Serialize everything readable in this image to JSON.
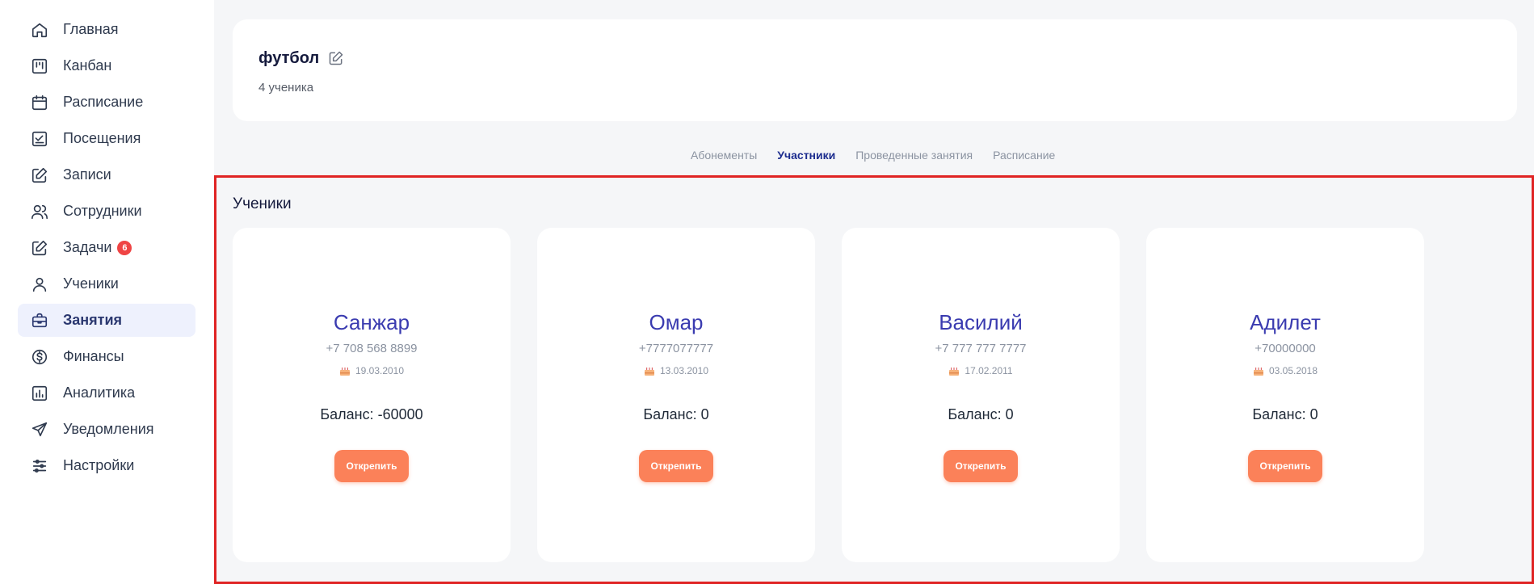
{
  "sidebar": {
    "items": [
      {
        "label": "Главная",
        "icon": "home-icon"
      },
      {
        "label": "Канбан",
        "icon": "kanban-icon"
      },
      {
        "label": "Расписание",
        "icon": "calendar-icon"
      },
      {
        "label": "Посещения",
        "icon": "chart-check-icon"
      },
      {
        "label": "Записи",
        "icon": "edit-note-icon"
      },
      {
        "label": "Сотрудники",
        "icon": "users-icon"
      },
      {
        "label": "Задачи",
        "icon": "tasks-icon",
        "badge": "6"
      },
      {
        "label": "Ученики",
        "icon": "user-icon"
      },
      {
        "label": "Занятия",
        "icon": "briefcase-icon",
        "active": true
      },
      {
        "label": "Финансы",
        "icon": "dollar-icon"
      },
      {
        "label": "Аналитика",
        "icon": "bar-chart-icon"
      },
      {
        "label": "Уведомления",
        "icon": "send-icon"
      },
      {
        "label": "Настройки",
        "icon": "sliders-icon"
      }
    ]
  },
  "header": {
    "title": "футбол",
    "subtitle": "4 ученика"
  },
  "tabs": [
    {
      "label": "Абонементы"
    },
    {
      "label": "Участники",
      "active": true
    },
    {
      "label": "Проведенные занятия"
    },
    {
      "label": "Расписание"
    }
  ],
  "section": {
    "title": "Ученики"
  },
  "students": [
    {
      "name": "Санжар",
      "phone": "+7 708 568 8899",
      "birthdate": "19.03.2010",
      "balance": "Баланс: -60000",
      "button": "Открепить"
    },
    {
      "name": "Омар",
      "phone": "+7777077777",
      "birthdate": "13.03.2010",
      "balance": "Баланс: 0",
      "button": "Открепить"
    },
    {
      "name": "Василий",
      "phone": "+7 777 777 7777",
      "birthdate": "17.02.2011",
      "balance": "Баланс: 0",
      "button": "Открепить"
    },
    {
      "name": "Адилет",
      "phone": "+70000000",
      "birthdate": "03.05.2018",
      "balance": "Баланс: 0",
      "button": "Открепить"
    }
  ],
  "colors": {
    "accent": "#3a3bb0",
    "button": "#fb8159",
    "highlight_border": "#e02424",
    "badge": "#ef4444"
  }
}
